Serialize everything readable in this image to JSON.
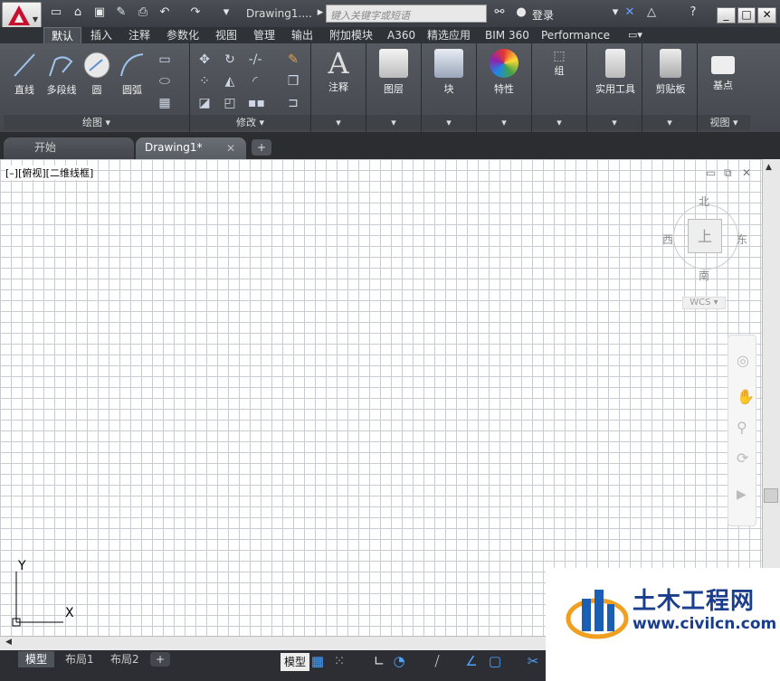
{
  "title": {
    "document": "Drawing1....",
    "search_placeholder": "键入关键字或短语",
    "login": "登录"
  },
  "ribbon_tabs": [
    "默认",
    "插入",
    "注释",
    "参数化",
    "视图",
    "管理",
    "输出",
    "附加模块",
    "A360",
    "精选应用",
    "BIM 360",
    "Performance"
  ],
  "panels": {
    "draw": {
      "label": "绘图 ▾",
      "buttons": [
        "直线",
        "多段线",
        "圆",
        "圆弧"
      ]
    },
    "modify": {
      "label": "修改 ▾"
    },
    "annotation": {
      "label": "注释"
    },
    "layers": {
      "label": "图层"
    },
    "block": {
      "label": "块"
    },
    "properties": {
      "label": "特性"
    },
    "group": {
      "label": "组"
    },
    "utilities": {
      "label": "实用工具"
    },
    "clipboard": {
      "label": "剪贴板"
    },
    "view": {
      "label": "视图 ▾",
      "button": "基点"
    }
  },
  "doc_tabs": {
    "start": "开始",
    "drawing": "Drawing1*"
  },
  "viewport_label": "[–][俯视][二维线框]",
  "viewcube": {
    "north": "北",
    "south": "南",
    "east": "东",
    "west": "西",
    "top": "上",
    "wcs": "WCS ▾"
  },
  "ucs": {
    "y": "Y",
    "x": "X"
  },
  "layout_tabs": [
    "模型",
    "布局1",
    "布局2"
  ],
  "status": {
    "model": "模型"
  },
  "watermark": {
    "cn": "土木工程网",
    "url": "www.civilcn.com"
  }
}
